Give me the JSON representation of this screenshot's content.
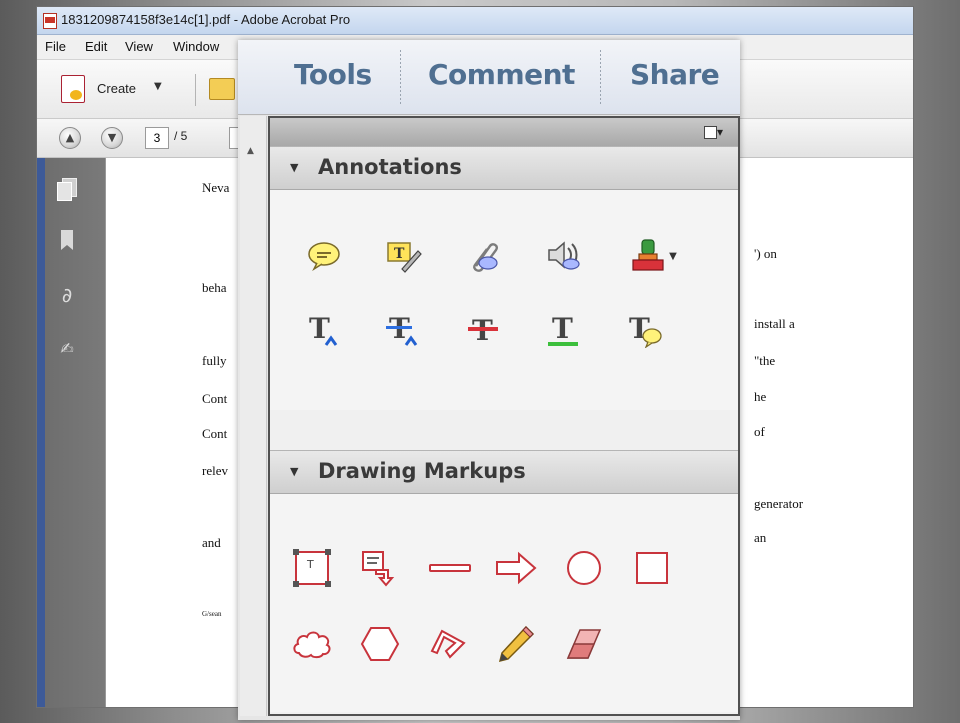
{
  "window": {
    "title": "1831209874158f3e14c[1].pdf - Adobe Acrobat Pro"
  },
  "menu": [
    "File",
    "Edit",
    "View",
    "Window"
  ],
  "toolbar": {
    "create_label": "Create",
    "page_current": "3",
    "page_total": "/ 5"
  },
  "tools_pane": {
    "tabs": [
      "Tools",
      "Comment",
      "Share"
    ],
    "sections": {
      "annotations": "Annotations",
      "drawing_markups": "Drawing Markups"
    }
  },
  "annotation_tools": [
    "sticky-note-icon",
    "highlight-text-icon",
    "attach-file-icon",
    "record-audio-icon",
    "add-stamp-icon",
    "insert-text-icon",
    "replace-text-icon",
    "strikethrough-icon",
    "underline-icon",
    "add-note-to-text-icon"
  ],
  "drawing_tools": [
    "text-box-icon",
    "callout-icon",
    "line-icon",
    "arrow-icon",
    "oval-icon",
    "rectangle-icon",
    "cloud-icon",
    "polygon-icon",
    "connected-lines-icon",
    "pencil-icon",
    "eraser-icon"
  ],
  "document": {
    "left_fragments": [
      "Neva",
      "beha",
      "fully",
      "Cont",
      "Cont",
      "relev",
      "and",
      "G/sean"
    ],
    "right_fragments": [
      "') on",
      "install a",
      "\"the",
      "he",
      "of",
      "generator",
      "an"
    ]
  },
  "colors": {
    "tab_text": "#4f6f91",
    "markup_red": "#d9323a",
    "accent_blue": "#3d5a98"
  }
}
